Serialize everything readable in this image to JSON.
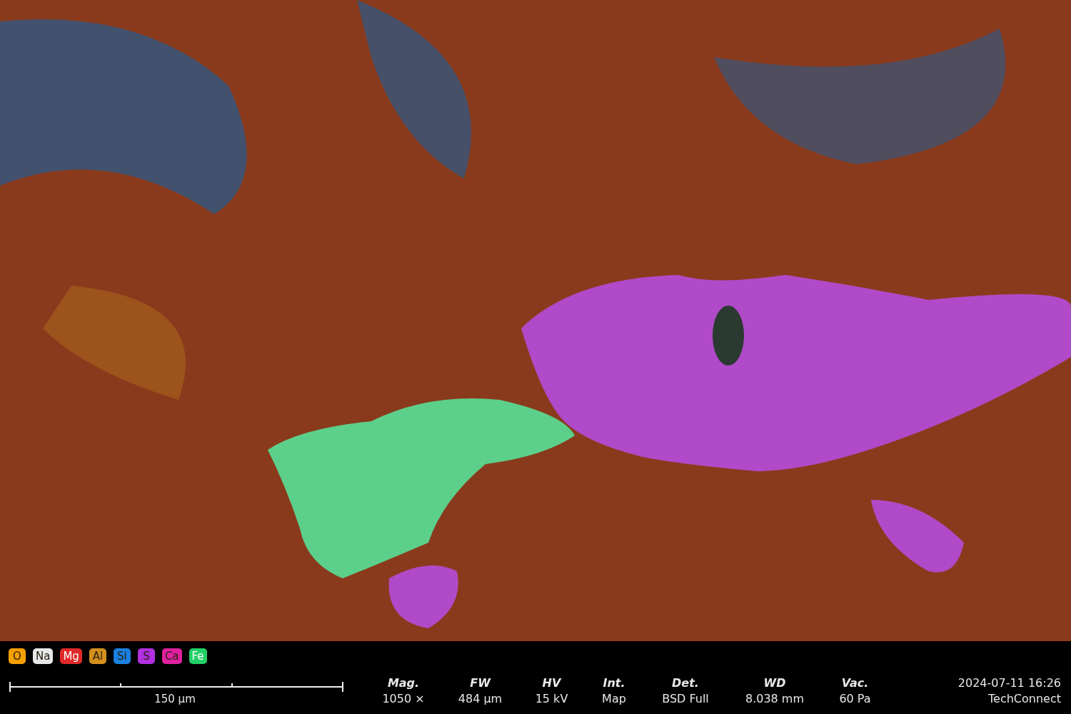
{
  "elements": [
    {
      "symbol": "O",
      "color": "#f5a000",
      "light_label": false
    },
    {
      "symbol": "Na",
      "color": "#e8e8e8",
      "light_label": false
    },
    {
      "symbol": "Mg",
      "color": "#e02828",
      "light_label": true
    },
    {
      "symbol": "Al",
      "color": "#d4901c",
      "light_label": false
    },
    {
      "symbol": "Si",
      "color": "#1a80e0",
      "light_label": false
    },
    {
      "symbol": "S",
      "color": "#b030e0",
      "light_label": false
    },
    {
      "symbol": "Ca",
      "color": "#e020a0",
      "light_label": false
    },
    {
      "symbol": "Fe",
      "color": "#22d068",
      "light_label": true
    }
  ],
  "scale_bar": {
    "label": "150 µm"
  },
  "parameters": [
    {
      "label": "Mag.",
      "value": "1050 ×"
    },
    {
      "label": "FW",
      "value": "484 µm"
    },
    {
      "label": "HV",
      "value": "15 kV"
    },
    {
      "label": "Int.",
      "value": "Map"
    },
    {
      "label": "Det.",
      "value": "BSD Full"
    },
    {
      "label": "WD",
      "value": "8.038 mm"
    },
    {
      "label": "Vac.",
      "value": "60 Pa"
    }
  ],
  "timestamp": "2024-07-11 16:26",
  "operator": "TechConnect"
}
